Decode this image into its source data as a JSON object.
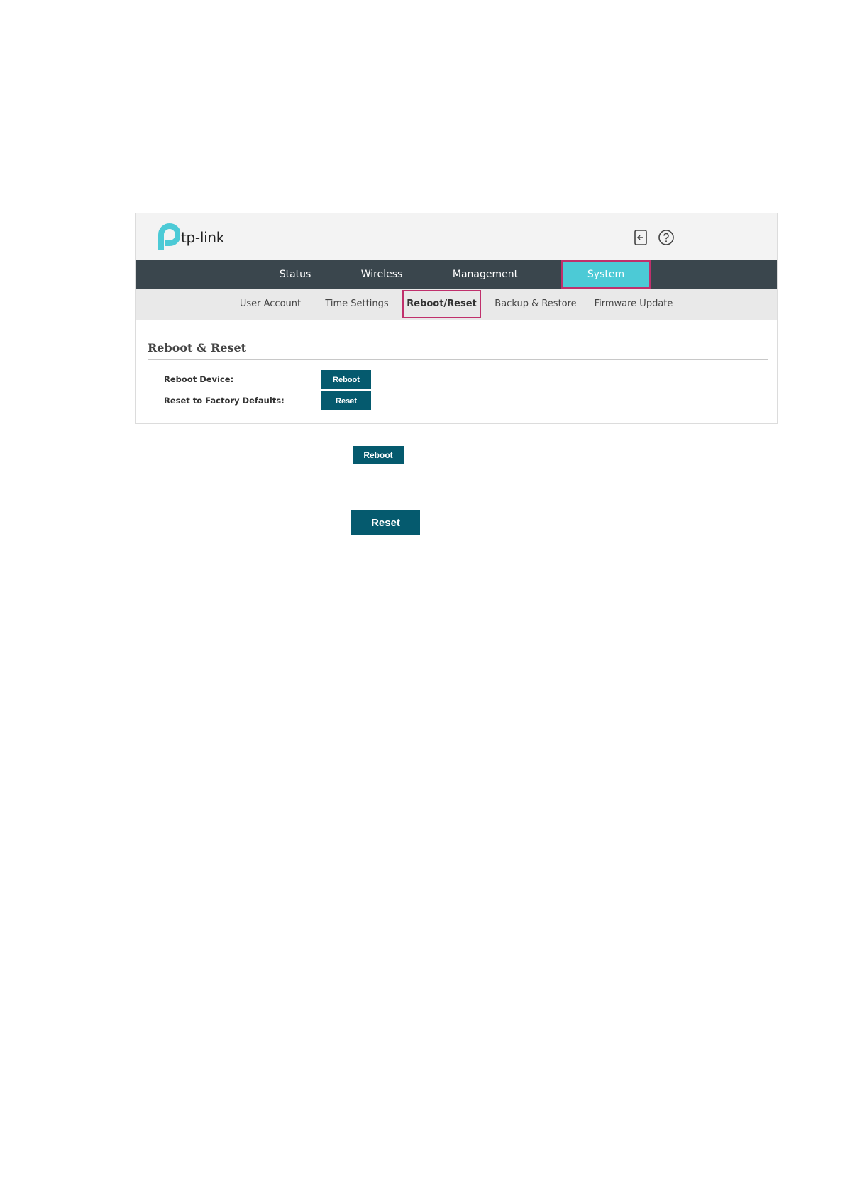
{
  "brand": {
    "name": "tp-link",
    "colors": {
      "teal": "#4ccad6",
      "dark_nav": "#3a464d",
      "button": "#055a6e",
      "highlight": "#c0306c"
    }
  },
  "header": {
    "icons": [
      "logout-icon",
      "help-icon"
    ]
  },
  "top_nav": {
    "tabs": [
      {
        "label": "Status"
      },
      {
        "label": "Wireless"
      },
      {
        "label": "Management"
      },
      {
        "label": "System",
        "active": true
      }
    ]
  },
  "sub_nav": {
    "tabs": [
      {
        "label": "User Account"
      },
      {
        "label": "Time Settings"
      },
      {
        "label": "Reboot/Reset",
        "active": true
      },
      {
        "label": "Backup & Restore"
      },
      {
        "label": "Firmware Update"
      }
    ]
  },
  "section": {
    "title": "Reboot & Reset",
    "rows": [
      {
        "label": "Reboot Device:",
        "button": "Reboot"
      },
      {
        "label": "Reset to Factory Defaults:",
        "button": "Reset"
      }
    ]
  },
  "doc_buttons": {
    "reboot": "Reboot",
    "reset": "Reset"
  }
}
